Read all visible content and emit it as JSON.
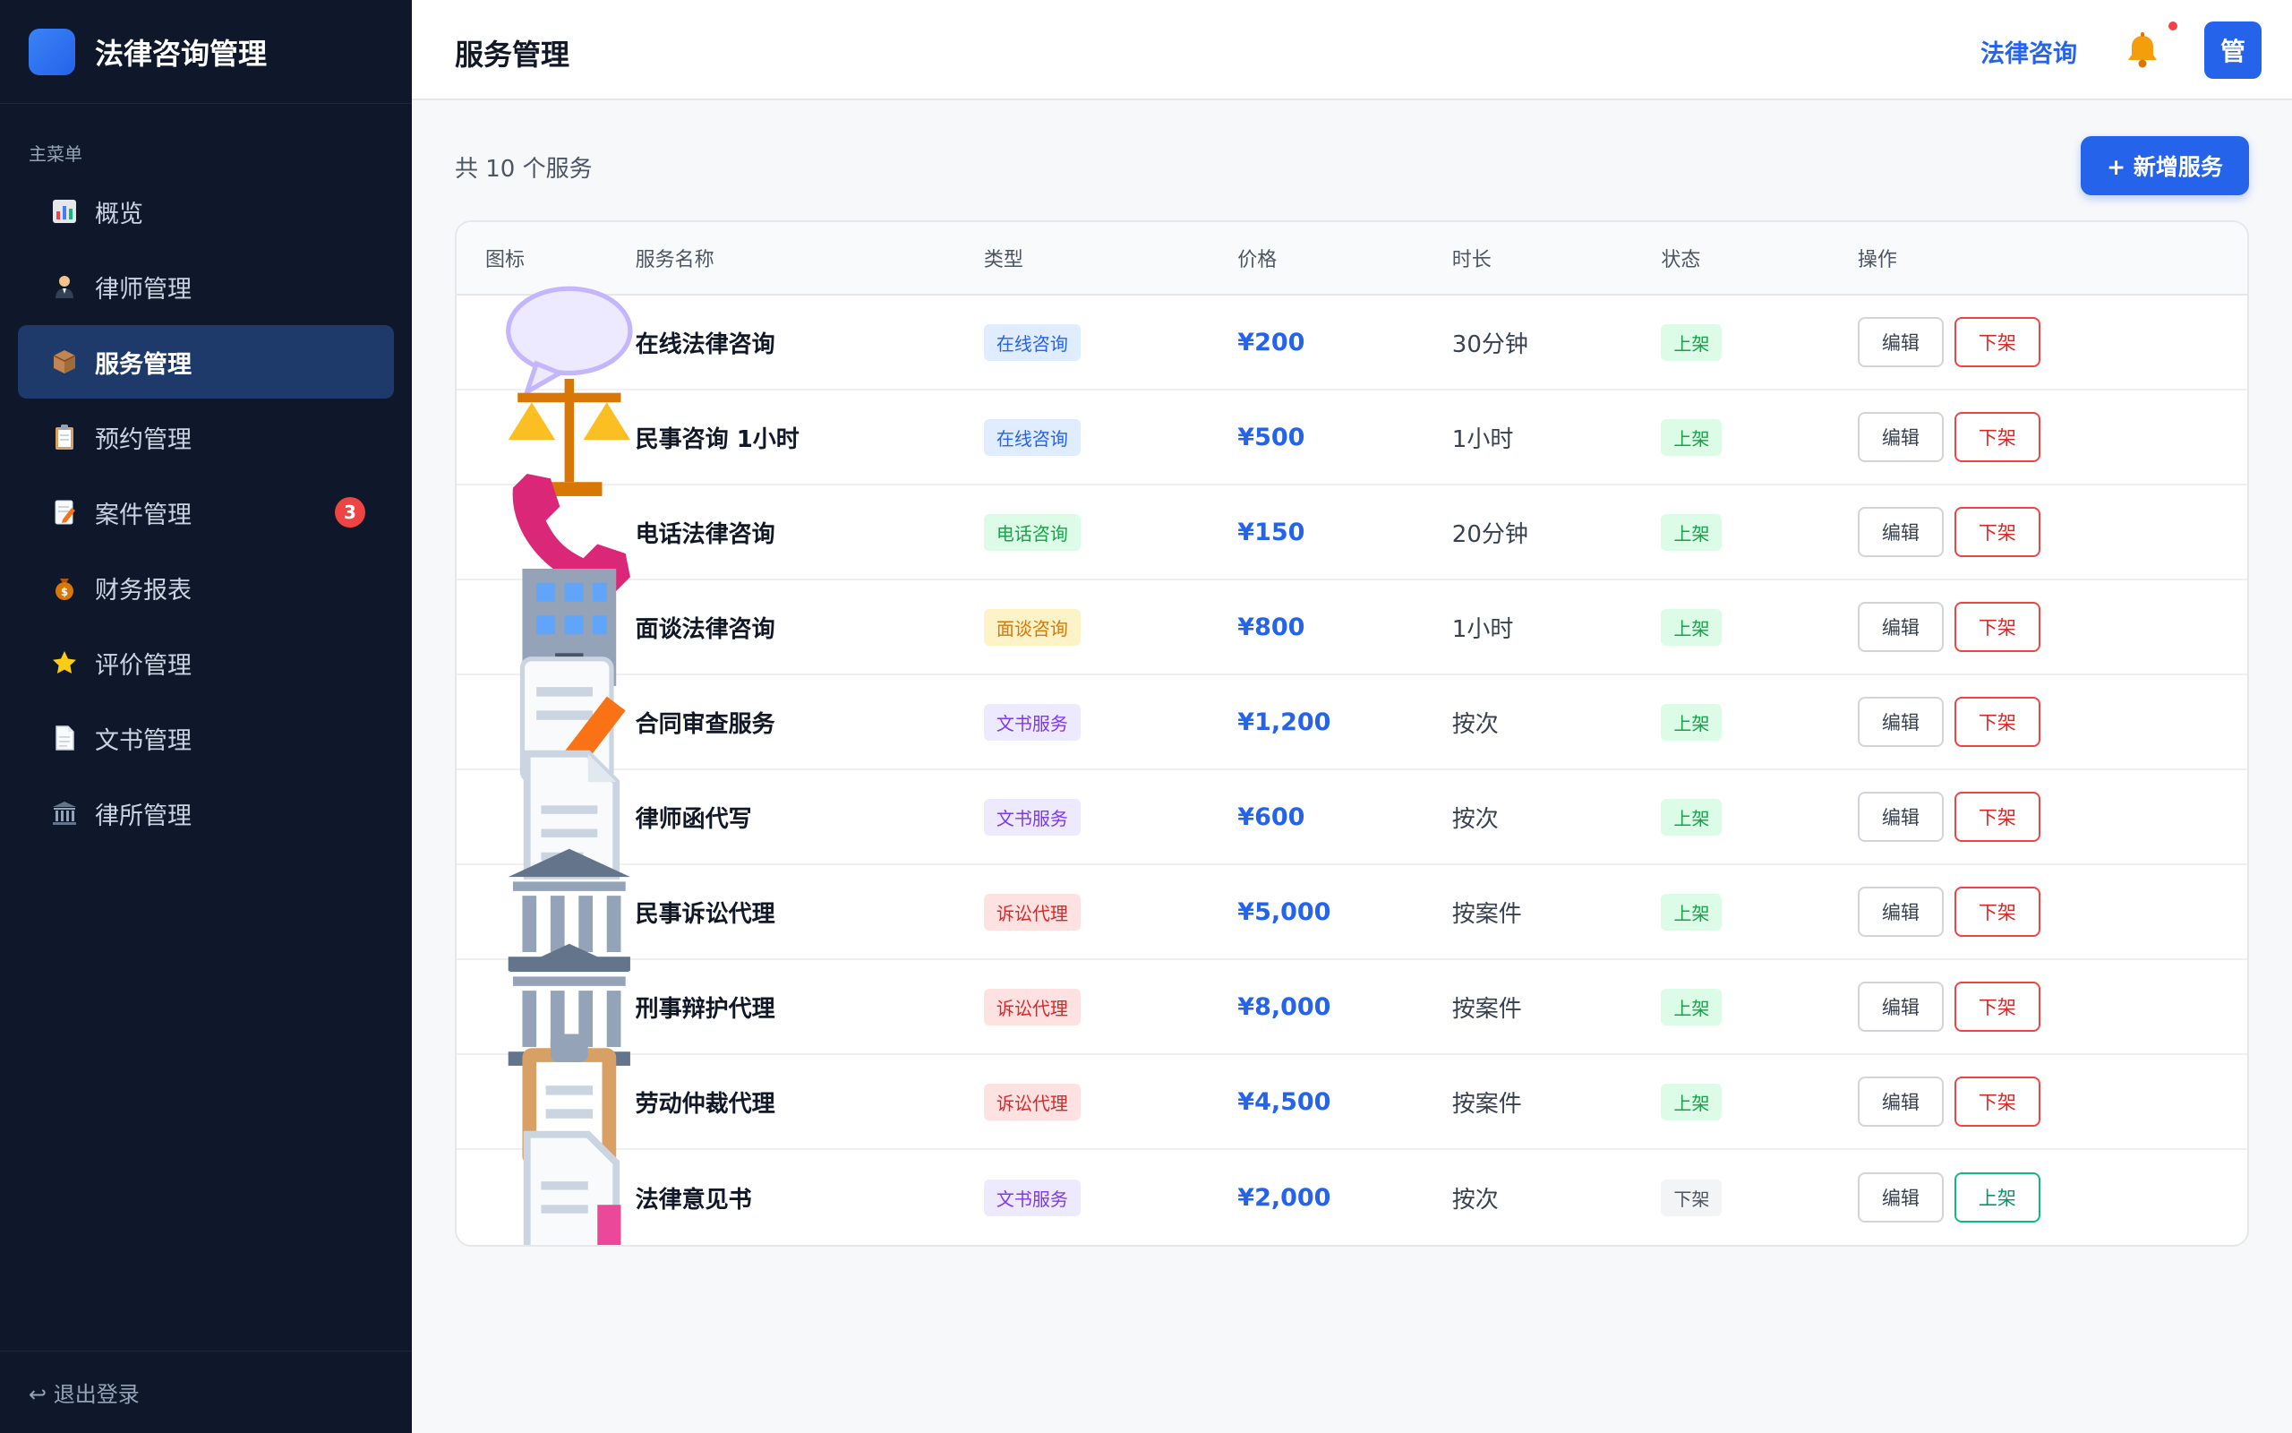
{
  "brand": {
    "title": "法律咨询管理",
    "logo_color": "#3b82f6"
  },
  "sidebar": {
    "caption": "主菜单",
    "items": [
      {
        "label": "概览",
        "icon": "chart-icon"
      },
      {
        "label": "律师管理",
        "icon": "lawyer-icon"
      },
      {
        "label": "服务管理",
        "icon": "package-icon",
        "active": true
      },
      {
        "label": "预约管理",
        "icon": "clipboard-icon"
      },
      {
        "label": "案件管理",
        "icon": "memo-icon",
        "badge": "3"
      },
      {
        "label": "财务报表",
        "icon": "moneybag-icon"
      },
      {
        "label": "评价管理",
        "icon": "star-icon"
      },
      {
        "label": "文书管理",
        "icon": "document-icon"
      },
      {
        "label": "律所管理",
        "icon": "courthouse-icon"
      }
    ],
    "logout": "↩ 退出登录"
  },
  "header": {
    "title": "服务管理",
    "link": "法律咨询",
    "avatar": "管",
    "accent": "#2563eb"
  },
  "toolbar": {
    "count_text": "共 10 个服务",
    "add_label": "+ 新增服务"
  },
  "table": {
    "columns": [
      "图标",
      "服务名称",
      "类型",
      "价格",
      "时长",
      "状态",
      "操作"
    ],
    "edit_label": "编辑",
    "rows": [
      {
        "icon": "speech-bubble-icon",
        "name": "在线法律咨询",
        "type": "在线咨询",
        "type_kind": "online",
        "price": "¥200",
        "duration": "30分钟",
        "status": "上架",
        "status_kind": "on",
        "action": "下架"
      },
      {
        "icon": "scales-icon",
        "name": "民事咨询 1小时",
        "type": "在线咨询",
        "type_kind": "online",
        "price": "¥500",
        "duration": "1小时",
        "status": "上架",
        "status_kind": "on",
        "action": "下架"
      },
      {
        "icon": "phone-icon",
        "name": "电话法律咨询",
        "type": "电话咨询",
        "type_kind": "phone",
        "price": "¥150",
        "duration": "20分钟",
        "status": "上架",
        "status_kind": "on",
        "action": "下架"
      },
      {
        "icon": "office-building-icon",
        "name": "面谈法律咨询",
        "type": "面谈咨询",
        "type_kind": "face",
        "price": "¥800",
        "duration": "1小时",
        "status": "上架",
        "status_kind": "on",
        "action": "下架"
      },
      {
        "icon": "memo-icon",
        "name": "合同审查服务",
        "type": "文书服务",
        "type_kind": "doc",
        "price": "¥1,200",
        "duration": "按次",
        "status": "上架",
        "status_kind": "on",
        "action": "下架"
      },
      {
        "icon": "document-icon",
        "name": "律师函代写",
        "type": "文书服务",
        "type_kind": "doc",
        "price": "¥600",
        "duration": "按次",
        "status": "上架",
        "status_kind": "on",
        "action": "下架"
      },
      {
        "icon": "courthouse-icon",
        "name": "民事诉讼代理",
        "type": "诉讼代理",
        "type_kind": "lit",
        "price": "¥5,000",
        "duration": "按案件",
        "status": "上架",
        "status_kind": "on",
        "action": "下架"
      },
      {
        "icon": "courthouse-icon",
        "name": "刑事辩护代理",
        "type": "诉讼代理",
        "type_kind": "lit",
        "price": "¥8,000",
        "duration": "按案件",
        "status": "上架",
        "status_kind": "on",
        "action": "下架"
      },
      {
        "icon": "clipboard-icon",
        "name": "劳动仲裁代理",
        "type": "诉讼代理",
        "type_kind": "lit",
        "price": "¥4,500",
        "duration": "按案件",
        "status": "上架",
        "status_kind": "on",
        "action": "下架"
      },
      {
        "icon": "bookmark-document-icon",
        "name": "法律意见书",
        "type": "文书服务",
        "type_kind": "doc",
        "price": "¥2,000",
        "duration": "按次",
        "status": "下架",
        "status_kind": "off",
        "action": "上架"
      }
    ]
  }
}
